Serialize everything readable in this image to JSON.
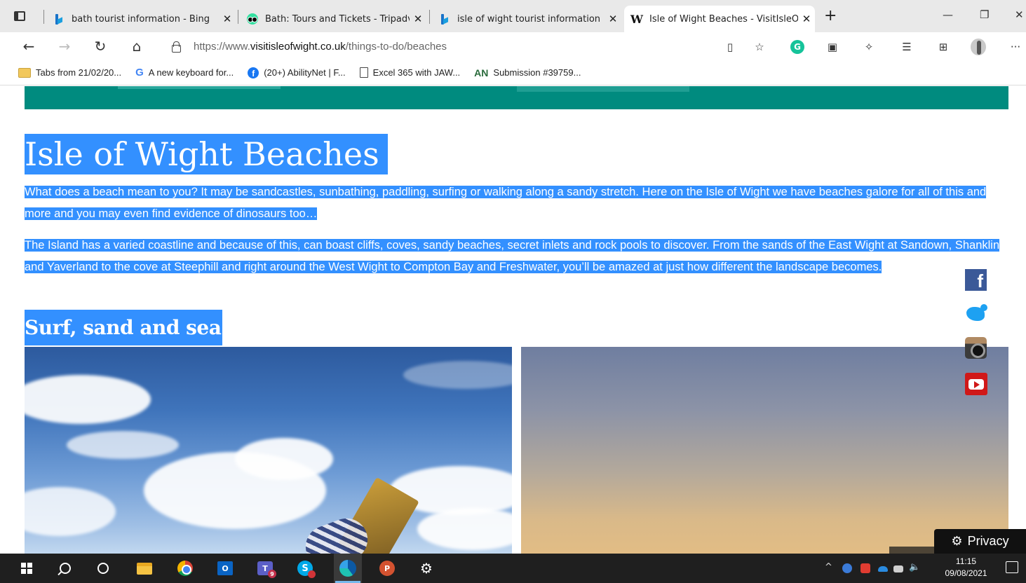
{
  "browser": {
    "tabs": [
      {
        "title": "bath tourist information - Bing",
        "favicon": "bing-icon"
      },
      {
        "title": "Bath: Tours and Tickets - Tripadvi",
        "favicon": "tripadvisor-icon"
      },
      {
        "title": "isle of wight tourist information",
        "favicon": "bing-icon"
      },
      {
        "title": "Isle of Wight Beaches - VisitIsleO",
        "favicon": "visitisleofwight-icon",
        "active": true
      }
    ],
    "url_prefix": "https://www.",
    "url_domain": "visitisleofwight.co.uk",
    "url_path": "/things-to-do/beaches"
  },
  "favourites": [
    {
      "label": "Tabs from 21/02/20...",
      "icon": "folder-icon"
    },
    {
      "label": "A new keyboard for...",
      "icon": "google-icon"
    },
    {
      "label": "(20+) AbilityNet | F...",
      "icon": "facebook-icon"
    },
    {
      "label": "Excel 365 with JAW...",
      "icon": "page-icon"
    },
    {
      "label": "Submission #39759...",
      "icon": "abilitynet-icon"
    }
  ],
  "page": {
    "title": "Isle of Wight Beaches",
    "intro": "What does a beach mean to you? It may be sandcastles, sunbathing, paddling, surfing or walking along a sandy stretch. Here on the Isle of Wight we have beaches galore for all of this and more and you may even find evidence of dinosaurs too…",
    "body": "The Island has a varied coastline and because of this, can boast cliffs, coves, sandy beaches, secret inlets and rock pools to discover. From the sands of the East Wight at Sandown, Shanklin and Yaverland to the cove at Steephill and right around the West Wight to Compton Bay and Freshwater, you’ll be amazed at just how different the landscape becomes.",
    "section_heading": "Surf, sand and sea",
    "privacy_label": "Privacy",
    "selection_color": "#3390ff",
    "band_color": "#008b7f"
  },
  "taskbar": {
    "time": "11:15",
    "date": "09/08/2021"
  }
}
